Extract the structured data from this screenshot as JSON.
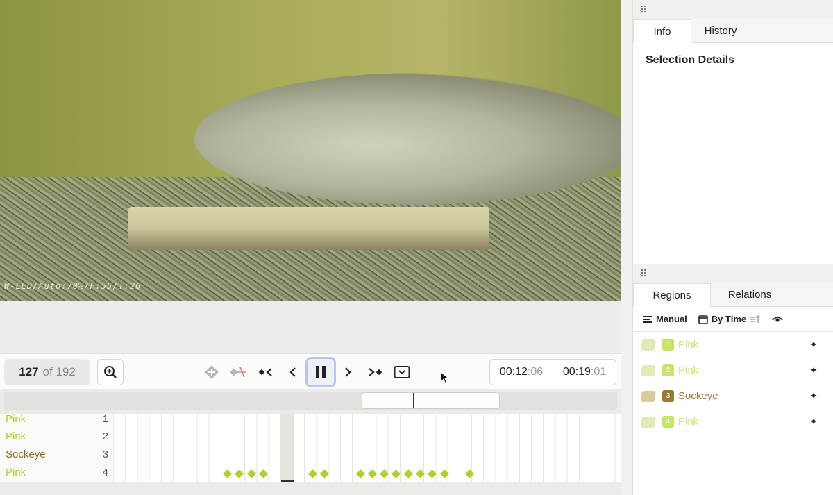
{
  "video": {
    "osd_text": "W-LED/Auto:70%/F:55/T:26"
  },
  "controls": {
    "frame_current": "127",
    "frame_of": "of 192",
    "time_current_main": "00:12",
    "time_current_frac": ":06",
    "time_total_main": "00:19",
    "time_total_frac": ":01"
  },
  "tracks": [
    {
      "label": "Pink",
      "num": "1",
      "color": "#a8d42a"
    },
    {
      "label": "Pink",
      "num": "2",
      "color": "#a8d42a"
    },
    {
      "label": "Sockeye",
      "num": "3",
      "color": "#8a6a23"
    },
    {
      "label": "Pink",
      "num": "4",
      "color": "#a8d42a"
    }
  ],
  "keyframe_track": 4,
  "side_panel": {
    "top_tabs": [
      "Info",
      "History"
    ],
    "active_top_tab": "Info",
    "selection_title": "Selection Details",
    "bottom_tabs": [
      "Regions",
      "Relations"
    ],
    "active_bottom_tab": "Regions",
    "sort_manual": "Manual",
    "sort_by_time": "By Time",
    "regions": [
      {
        "index": "1",
        "label": "Pink",
        "color": "#c6e46a",
        "thumb": "#e2e8b8"
      },
      {
        "index": "2",
        "label": "Pink",
        "color": "#c6e46a",
        "thumb": "#e2e8b8"
      },
      {
        "index": "3",
        "label": "Sockeye",
        "color": "#9a7a32",
        "thumb": "#d8c9a0"
      },
      {
        "index": "4",
        "label": "Pink",
        "color": "#c6e46a",
        "thumb": "#e2e8b8"
      }
    ]
  },
  "colors": {
    "pink": "#a8d42a",
    "sockeye": "#8a6a23",
    "play_focus": "#b8c4f4"
  }
}
